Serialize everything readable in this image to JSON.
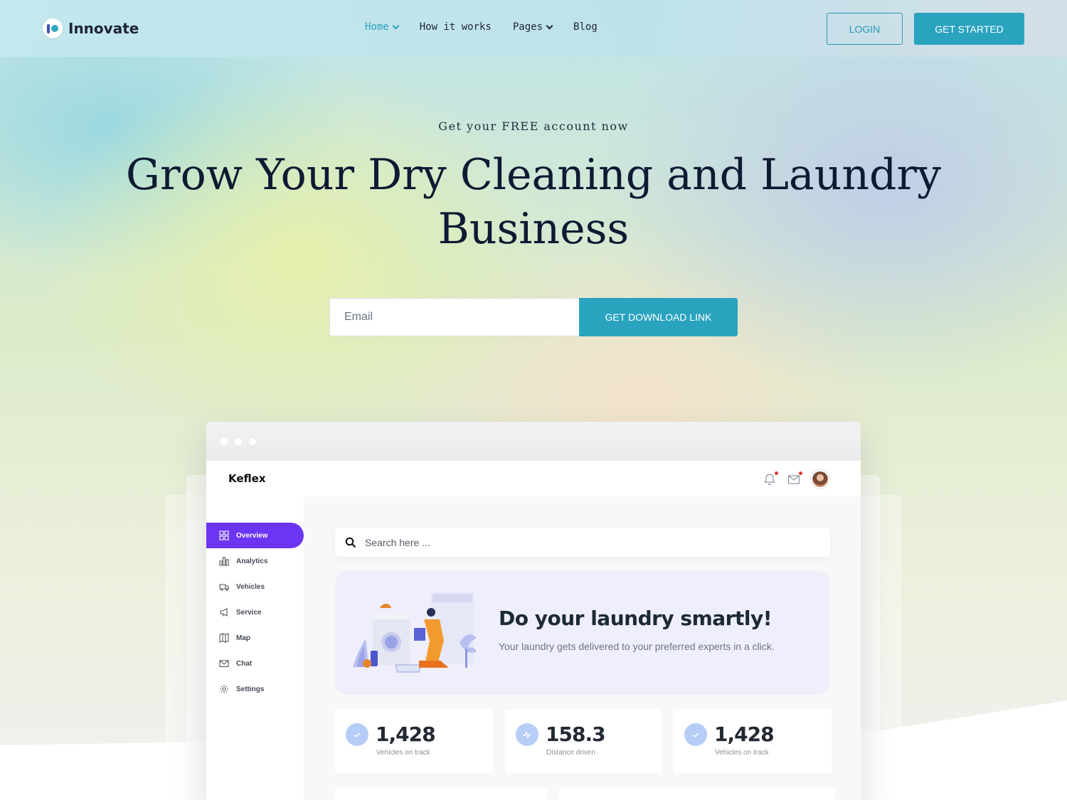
{
  "header": {
    "brand": "Innovate",
    "nav": [
      {
        "label": "Home",
        "dropdown": true,
        "active": true
      },
      {
        "label": "How it works",
        "dropdown": false,
        "active": false
      },
      {
        "label": "Pages",
        "dropdown": true,
        "active": false
      },
      {
        "label": "Blog",
        "dropdown": false,
        "active": false
      }
    ],
    "login_label": "LOGIN",
    "cta_label": "GET STARTED"
  },
  "hero": {
    "kicker": "Get your FREE account now",
    "title": "Grow Your Dry Cleaning and Laundry Business",
    "email_placeholder": "Email",
    "submit_label": "GET DOWNLOAD LINK"
  },
  "mockup": {
    "app_name": "Keflex",
    "sidebar": [
      {
        "label": "Overview",
        "icon": "grid-icon",
        "active": true
      },
      {
        "label": "Analytics",
        "icon": "bar-chart-icon",
        "active": false
      },
      {
        "label": "Vehicles",
        "icon": "truck-icon",
        "active": false
      },
      {
        "label": "Service",
        "icon": "megaphone-icon",
        "active": false
      },
      {
        "label": "Map",
        "icon": "map-icon",
        "active": false
      },
      {
        "label": "Chat",
        "icon": "mail-icon",
        "active": false
      },
      {
        "label": "Settings",
        "icon": "gear-icon",
        "active": false
      }
    ],
    "search_placeholder": "Search here ...",
    "banner": {
      "title": "Do your laundry smartly!",
      "subtitle": "Your laundry gets delivered to your preferred experts in a click."
    },
    "stats": [
      {
        "value": "1,428",
        "label": "Vehicles on track",
        "icon": "check-icon"
      },
      {
        "value": "158.3",
        "label": "Distance driven",
        "icon": "activity-icon"
      },
      {
        "value": "1,428",
        "label": "Vehicles on track",
        "icon": "check-icon"
      }
    ]
  },
  "colors": {
    "accent": "#2aa3bf",
    "sidebar_active": "#6c35f2",
    "banner_bg": "#efeefb",
    "heading": "#0e1a33"
  }
}
